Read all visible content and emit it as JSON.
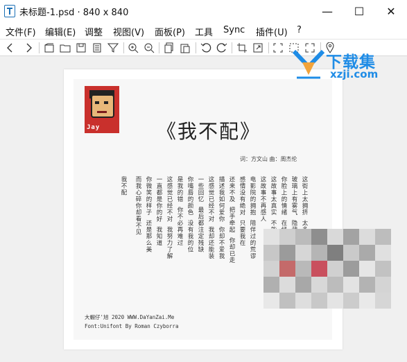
{
  "window": {
    "title": "未标题-1.psd · 840 x 840",
    "minimize": "—",
    "maximize": "☐",
    "close": "✕"
  },
  "menu": [
    "文件(F)",
    "编辑(E)",
    "调整",
    "视图(V)",
    "面板(P)",
    "工具",
    "Sync",
    "插件(U)",
    "?"
  ],
  "toolbar": {
    "icons": [
      "back-icon",
      "forward-icon",
      "new-file-icon",
      "open-folder-icon",
      "save-icon",
      "copy-doc-icon",
      "filter-icon",
      "zoom-in-icon",
      "zoom-out-icon",
      "copy-icon",
      "paste-icon",
      "undo-icon",
      "redo-icon",
      "crop-icon",
      "resize-icon",
      "marquee-icon",
      "marquee-dotted-icon",
      "transform-icon",
      "pin-icon"
    ]
  },
  "poster": {
    "avatar_tag": "Jay",
    "title": "《我不配》",
    "credits": "词：方文山   曲：周杰伦",
    "lyrics": [
      "这街上太拥挤 太多人有秘密",
      "玻璃上有雾气 隐藏着过去",
      "你脸上的情绪 在经过那场雨",
      "这故事太真实 不能当故事",
      "这故事不再感人",
      "电影院的拥抱 陪伴过的荒谬",
      "感情没有绝对 只要我在",
      "还来不及 把手牵起 你却已走",
      "描述我如何爱你 你却不爱我",
      "这感觉已经不对 我却还能装",
      "一些回忆 最后都注定残缺",
      "你嘴唇的颜色 没有我的位",
      "是我的错 你不必再难过",
      "这感觉已经不对 我努力了解",
      "一直都是你的好 我知道",
      "你微笑的样子 还是那么美",
      "而我心碎你却看不见",
      "我不配"
    ],
    "footer": [
      "大蝦仔'旭 2020 WWW.DaYanZai.Me",
      "Font:Unifont By Roman Czyborra"
    ]
  },
  "watermark": {
    "cn": "下载集",
    "en": "xzji.com"
  },
  "colors": {
    "accent": "#1f8ce6",
    "avatar_bg": "#c9302c"
  }
}
